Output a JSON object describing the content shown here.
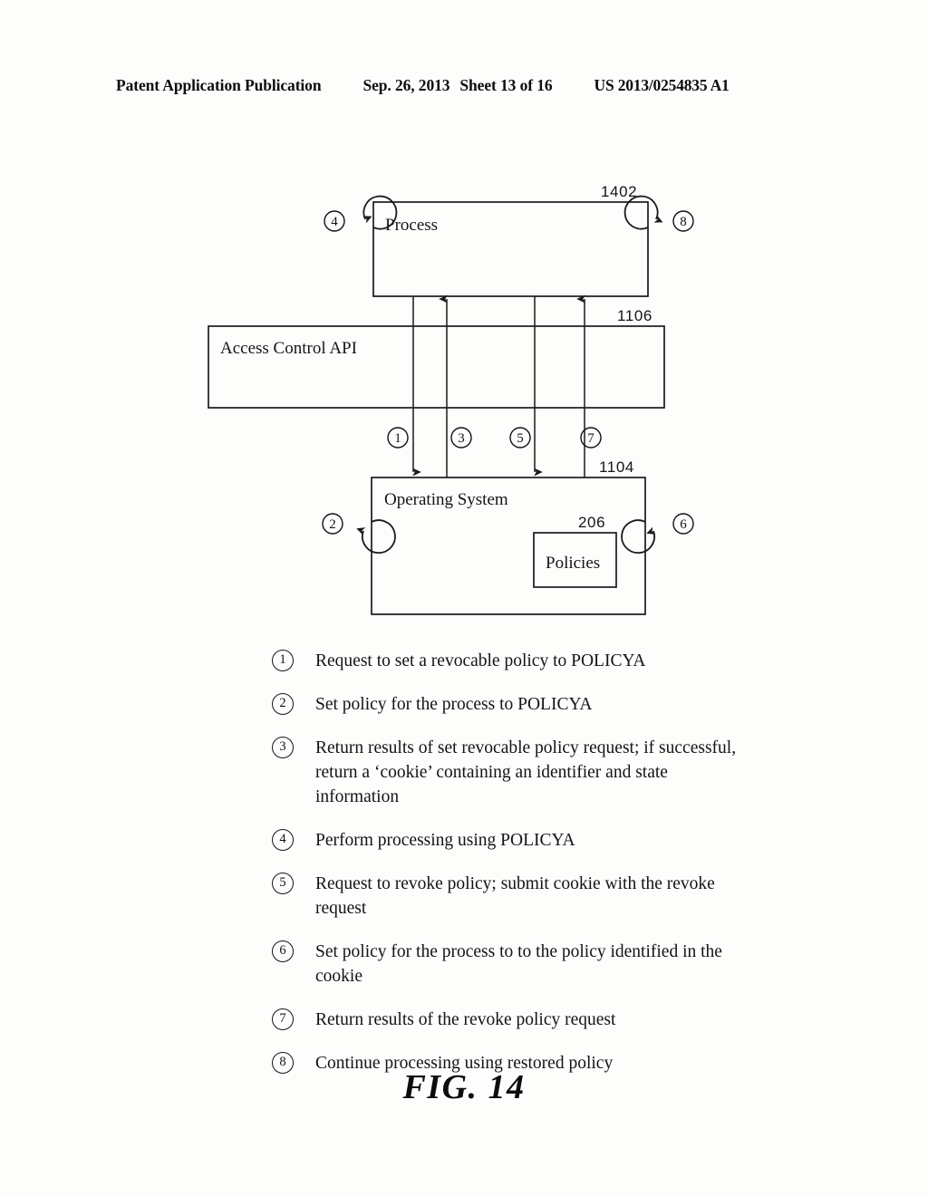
{
  "header": {
    "publication": "Patent Application Publication",
    "date": "Sep. 26, 2013",
    "sheet": "Sheet 13 of 16",
    "document_number": "US 2013/0254835 A1"
  },
  "diagram": {
    "boxes": {
      "process": {
        "label": "Process",
        "ref": "1402"
      },
      "access_control_api": {
        "label": "Access Control API",
        "ref": "1106"
      },
      "operating_system": {
        "label": "Operating System",
        "ref": "1104"
      },
      "policies": {
        "label": "Policies",
        "ref": "206"
      }
    },
    "self_loops": {
      "loop4": "4",
      "loop8": "8",
      "loop2": "2",
      "loop6": "6"
    },
    "connector_markers": {
      "c1": "1",
      "c3": "3",
      "c5": "5",
      "c7": "7"
    }
  },
  "legend": {
    "items": [
      {
        "num": "1",
        "text": "Request to set a revocable policy to POLICYA"
      },
      {
        "num": "2",
        "text": "Set policy for the process to POLICYA"
      },
      {
        "num": "3",
        "text": "Return results of set revocable policy request; if successful, return a ‘cookie’ containing an identifier and state information"
      },
      {
        "num": "4",
        "text": "Perform processing using POLICYA"
      },
      {
        "num": "5",
        "text": "Request to revoke policy; submit cookie with the revoke request"
      },
      {
        "num": "6",
        "text": "Set policy for the process to to the policy identified in the cookie"
      },
      {
        "num": "7",
        "text": "Return results of the revoke policy request"
      },
      {
        "num": "8",
        "text": "Continue processing using restored policy"
      }
    ]
  },
  "figure": {
    "caption": "FIG. 14"
  },
  "colors": {
    "ink": "#1b1b1b",
    "paper": "#fdfdfb"
  }
}
